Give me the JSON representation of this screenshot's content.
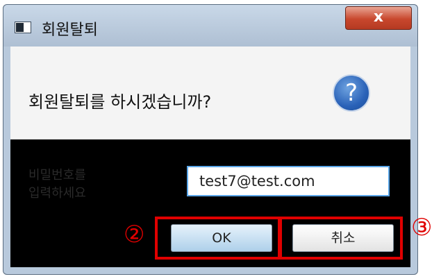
{
  "dialog": {
    "title": "회원탈퇴",
    "close_label": "x",
    "question": "회원탈퇴를 하시겠습니까?",
    "question_icon": "?",
    "password_label_line1": "비밀번호를",
    "password_label_line2": "입력하세요",
    "email_value": "test7@test.com",
    "ok_label": "OK",
    "cancel_label": "취소"
  },
  "annotations": {
    "marker_ok": "②",
    "marker_cancel": "③",
    "highlight_color": "#e00000"
  }
}
